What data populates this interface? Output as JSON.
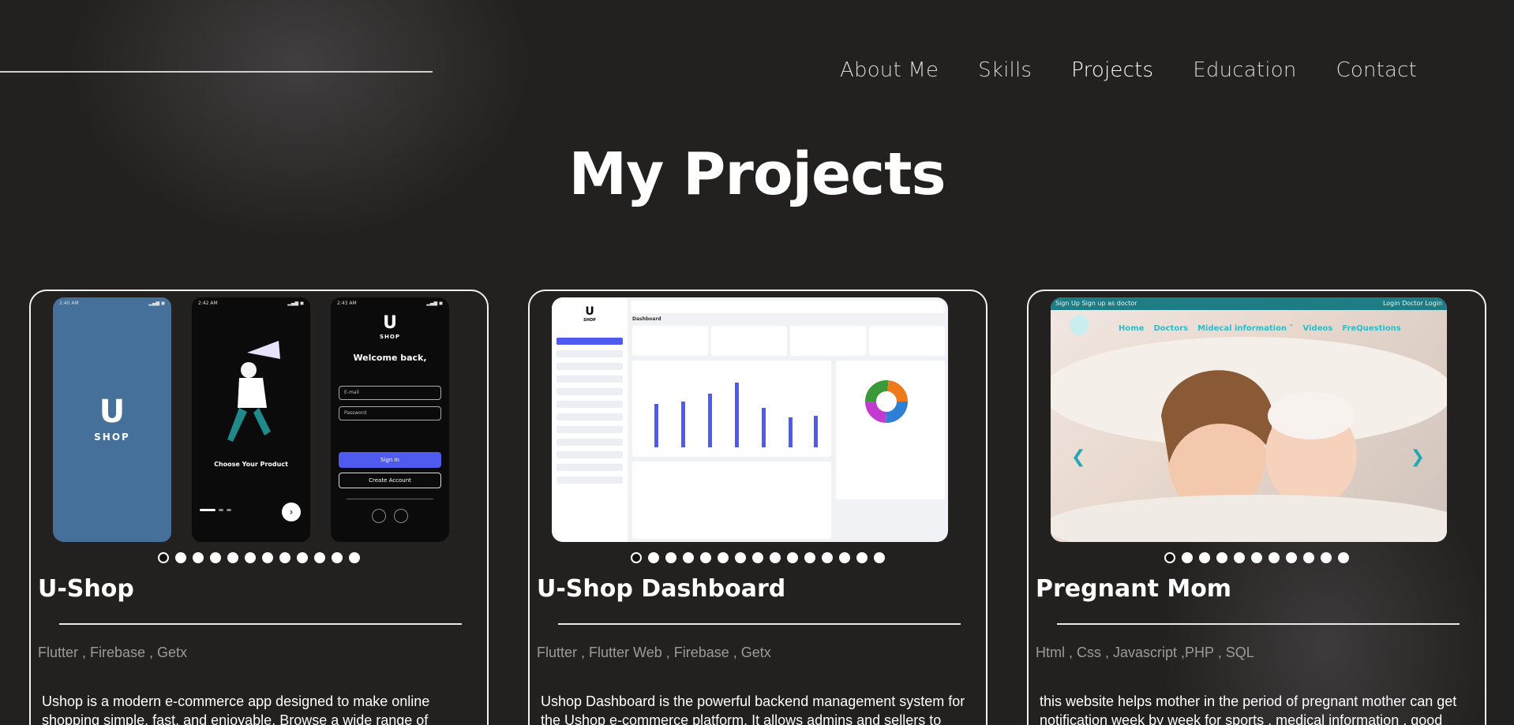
{
  "nav": {
    "items": [
      {
        "label": "About Me",
        "active": false
      },
      {
        "label": "Skills",
        "active": false
      },
      {
        "label": "Projects",
        "active": true
      },
      {
        "label": "Education",
        "active": false
      },
      {
        "label": "Contact",
        "active": false
      }
    ]
  },
  "page": {
    "title": "My Projects"
  },
  "projects": [
    {
      "title": "U-Shop",
      "tech": "Flutter , Firebase , Getx",
      "description": "Ushop is a modern e-commerce app designed to make online shopping simple, fast, and enjoyable. Browse a wide range of",
      "dot_count": 12,
      "active_dot": 0,
      "preview": {
        "logo_letter": "U",
        "logo_text": "SHOP",
        "onboarding_title": "Choose Your Product",
        "welcome_title": "Welcome back,",
        "email_placeholder": "E-mail",
        "password_placeholder": "Password",
        "sign_in_label": "Sign In",
        "create_account_label": "Create Account"
      }
    },
    {
      "title": "U-Shop Dashboard",
      "tech": "Flutter , Flutter Web , Firebase , Getx",
      "description": "Ushop Dashboard is the powerful backend management system for the Ushop e-commerce platform. It allows admins and sellers to",
      "dot_count": 15,
      "active_dot": 0,
      "preview": {
        "logo_letter": "U",
        "logo_text": "SHOP",
        "heading": "Dashboard"
      }
    },
    {
      "title": "Pregnant Mom",
      "tech": "Html , Css , Javascript ,PHP , SQL",
      "description": "this website helps mother in the period of pregnant mother can get notification week by week for sports , medical information , good",
      "dot_count": 11,
      "active_dot": 0,
      "preview": {
        "top_left": "Sign Up    Sign up as doctor",
        "top_right": "Login    Doctor Login",
        "menu": [
          "Home",
          "Doctors",
          "Midecal information ˅",
          "Videos",
          "FreQuestions"
        ]
      }
    }
  ],
  "colors": {
    "background": "#232020",
    "accent_blue": "#4f5bef",
    "site_teal": "#1d7c84",
    "muted_text": "#9b9b9b"
  }
}
